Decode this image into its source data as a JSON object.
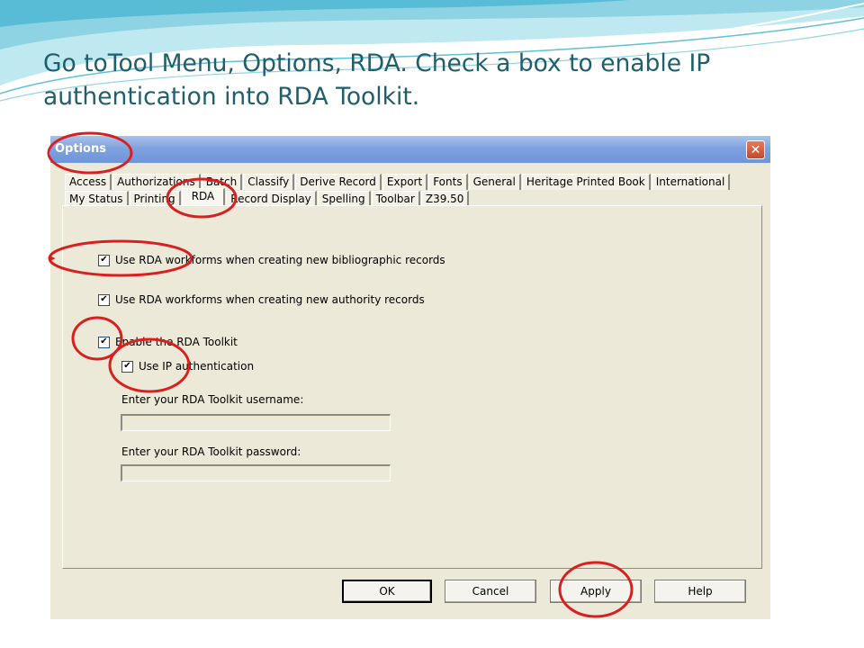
{
  "slide": {
    "title": "Go toTool Menu, Options, RDA. Check a box to enable IP authentication into RDA Toolkit."
  },
  "dialog": {
    "title": "Options",
    "close_glyph": "✕",
    "tabs_row1": [
      "Access",
      "Authorizations",
      "Batch",
      "Classify",
      "Derive Record",
      "Export",
      "Fonts",
      "General",
      "Heritage Printed Book",
      "International"
    ],
    "tabs_row2": [
      "My Status",
      "Printing",
      "RDA",
      "Record Display",
      "Spelling",
      "Toolbar",
      "Z39.50"
    ],
    "active_tab": "RDA",
    "options": [
      {
        "label": "Use RDA workforms when creating new bibliographic records",
        "checked": true
      },
      {
        "label": "Use RDA workforms when creating new authority records",
        "checked": true
      },
      {
        "label": "Enable the RDA Toolkit",
        "checked": true
      },
      {
        "label": "Use IP authentication",
        "checked": true
      }
    ],
    "check_glyph": "✔",
    "username_label": "Enter your RDA Toolkit username:",
    "username_value": "",
    "password_label": "Enter your RDA Toolkit password:",
    "password_value": "",
    "buttons": {
      "ok": "OK",
      "cancel": "Cancel",
      "apply": "Apply",
      "help": "Help"
    }
  },
  "colors": {
    "slide_title": "#1f5f6b",
    "annotation": "#d92020",
    "dialog_bg": "#ece9d8",
    "titlebar": "#7fa2de"
  },
  "icons": [
    "close-icon",
    "checkbox-checked-icon",
    "annotation-circle"
  ]
}
